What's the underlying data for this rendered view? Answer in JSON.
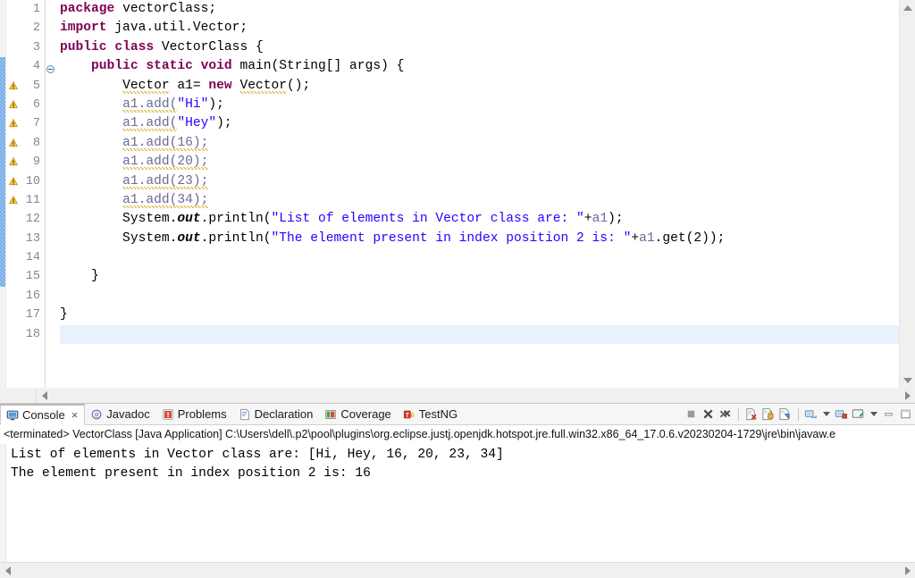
{
  "editor": {
    "lines": [
      {
        "num": "1",
        "indent": 0,
        "tokens": [
          {
            "t": "package",
            "c": "kw"
          },
          {
            "t": " vectorClass;",
            "c": ""
          }
        ]
      },
      {
        "num": "2",
        "indent": 0,
        "tokens": [
          {
            "t": "import",
            "c": "kw"
          },
          {
            "t": " java.util.Vector;",
            "c": ""
          }
        ]
      },
      {
        "num": "3",
        "indent": 0,
        "tokens": [
          {
            "t": "public",
            "c": "kw"
          },
          {
            "t": " ",
            "c": ""
          },
          {
            "t": "class",
            "c": "kw"
          },
          {
            "t": " VectorClass {",
            "c": ""
          }
        ]
      },
      {
        "num": "4",
        "indent": 0,
        "tokens": [
          {
            "t": "    ",
            "c": ""
          },
          {
            "t": "public",
            "c": "kw"
          },
          {
            "t": " ",
            "c": ""
          },
          {
            "t": "static",
            "c": "kw"
          },
          {
            "t": " ",
            "c": ""
          },
          {
            "t": "void",
            "c": "kw"
          },
          {
            "t": " main(String[] args) {",
            "c": ""
          }
        ]
      },
      {
        "num": "5",
        "indent": 0,
        "tokens": [
          {
            "t": "        ",
            "c": ""
          },
          {
            "t": "Vector",
            "c": "sq"
          },
          {
            "t": " a1= ",
            "c": ""
          },
          {
            "t": "new",
            "c": "kw"
          },
          {
            "t": " ",
            "c": ""
          },
          {
            "t": "Vector",
            "c": "sq"
          },
          {
            "t": "();",
            "c": ""
          }
        ]
      },
      {
        "num": "6",
        "indent": 0,
        "tokens": [
          {
            "t": "        ",
            "c": ""
          },
          {
            "t": "a1.add(",
            "c": "localvar sq"
          },
          {
            "t": "\"Hi\"",
            "c": "str"
          },
          {
            "t": ");",
            "c": ""
          }
        ]
      },
      {
        "num": "7",
        "indent": 0,
        "tokens": [
          {
            "t": "        ",
            "c": ""
          },
          {
            "t": "a1.add(",
            "c": "localvar sq"
          },
          {
            "t": "\"Hey\"",
            "c": "str"
          },
          {
            "t": ");",
            "c": ""
          }
        ]
      },
      {
        "num": "8",
        "indent": 0,
        "tokens": [
          {
            "t": "        ",
            "c": ""
          },
          {
            "t": "a1.add(16);",
            "c": "localvar sq"
          }
        ]
      },
      {
        "num": "9",
        "indent": 0,
        "tokens": [
          {
            "t": "        ",
            "c": ""
          },
          {
            "t": "a1.add(20);",
            "c": "localvar sq"
          }
        ]
      },
      {
        "num": "10",
        "indent": 0,
        "tokens": [
          {
            "t": "        ",
            "c": ""
          },
          {
            "t": "a1.add(23);",
            "c": "localvar sq"
          }
        ]
      },
      {
        "num": "11",
        "indent": 0,
        "tokens": [
          {
            "t": "        ",
            "c": ""
          },
          {
            "t": "a1.add(34);",
            "c": "localvar sq"
          }
        ]
      },
      {
        "num": "12",
        "indent": 0,
        "tokens": [
          {
            "t": "        System.",
            "c": ""
          },
          {
            "t": "out",
            "c": "fieldstatic"
          },
          {
            "t": ".println(",
            "c": ""
          },
          {
            "t": "\"List of elements in Vector class are: \"",
            "c": "str"
          },
          {
            "t": "+",
            "c": ""
          },
          {
            "t": "a1",
            "c": "localvar"
          },
          {
            "t": ");",
            "c": ""
          }
        ]
      },
      {
        "num": "13",
        "indent": 0,
        "tokens": [
          {
            "t": "        System.",
            "c": ""
          },
          {
            "t": "out",
            "c": "fieldstatic"
          },
          {
            "t": ".println(",
            "c": ""
          },
          {
            "t": "\"The element present in index position 2 is: \"",
            "c": "str"
          },
          {
            "t": "+",
            "c": ""
          },
          {
            "t": "a1",
            "c": "localvar"
          },
          {
            "t": ".get(2));",
            "c": ""
          }
        ]
      },
      {
        "num": "14",
        "indent": 0,
        "tokens": []
      },
      {
        "num": "15",
        "indent": 0,
        "tokens": [
          {
            "t": "    }",
            "c": ""
          }
        ]
      },
      {
        "num": "16",
        "indent": 0,
        "tokens": []
      },
      {
        "num": "17",
        "indent": 0,
        "tokens": [
          {
            "t": "}",
            "c": ""
          }
        ]
      },
      {
        "num": "18",
        "indent": 0,
        "tokens": []
      }
    ],
    "warning_lines": [
      5,
      6,
      7,
      8,
      9,
      10,
      11
    ],
    "fold_lines": [
      4
    ],
    "current_line": 18,
    "change_bar_from": 4,
    "change_bar_to": 15,
    "colors": {
      "keyword": "#7F0055",
      "string": "#2A00FF",
      "localvar": "#6A6A9A",
      "change_bar": "#6FA8E8",
      "current_line_highlight": "#E8F2FE",
      "gutter_text": "#888888",
      "warning_underline": "#D9B02A"
    }
  },
  "console": {
    "tabs": [
      {
        "label": "Console",
        "icon": "console-icon",
        "active": true,
        "closable": true
      },
      {
        "label": "Javadoc",
        "icon": "javadoc-icon",
        "active": false,
        "closable": false
      },
      {
        "label": "Problems",
        "icon": "problems-icon",
        "active": false,
        "closable": false
      },
      {
        "label": "Declaration",
        "icon": "declaration-icon",
        "active": false,
        "closable": false
      },
      {
        "label": "Coverage",
        "icon": "coverage-icon",
        "active": false,
        "closable": false
      },
      {
        "label": "TestNG",
        "icon": "testng-icon",
        "active": false,
        "closable": false
      }
    ],
    "toolbar_icons": [
      "terminate-icon",
      "remove-launch-icon",
      "remove-all-terminated-icon",
      "clear-console-icon",
      "scroll-lock-icon",
      "pin-console-icon",
      "display-selected-console-icon",
      "open-console-icon",
      "new-console-view-icon",
      "new-console-view-dropdown-icon",
      "open-console-dropdown-icon",
      "minimize-icon",
      "maximize-icon"
    ],
    "run_info": "<terminated> VectorClass [Java Application] C:\\Users\\dell\\.p2\\pool\\plugins\\org.eclipse.justj.openjdk.hotspot.jre.full.win32.x86_64_17.0.6.v20230204-1729\\jre\\bin\\javaw.e",
    "output": [
      "List of elements in Vector class are: [Hi, Hey, 16, 20, 23, 34]",
      "The element present in index position 2 is: 16"
    ]
  }
}
